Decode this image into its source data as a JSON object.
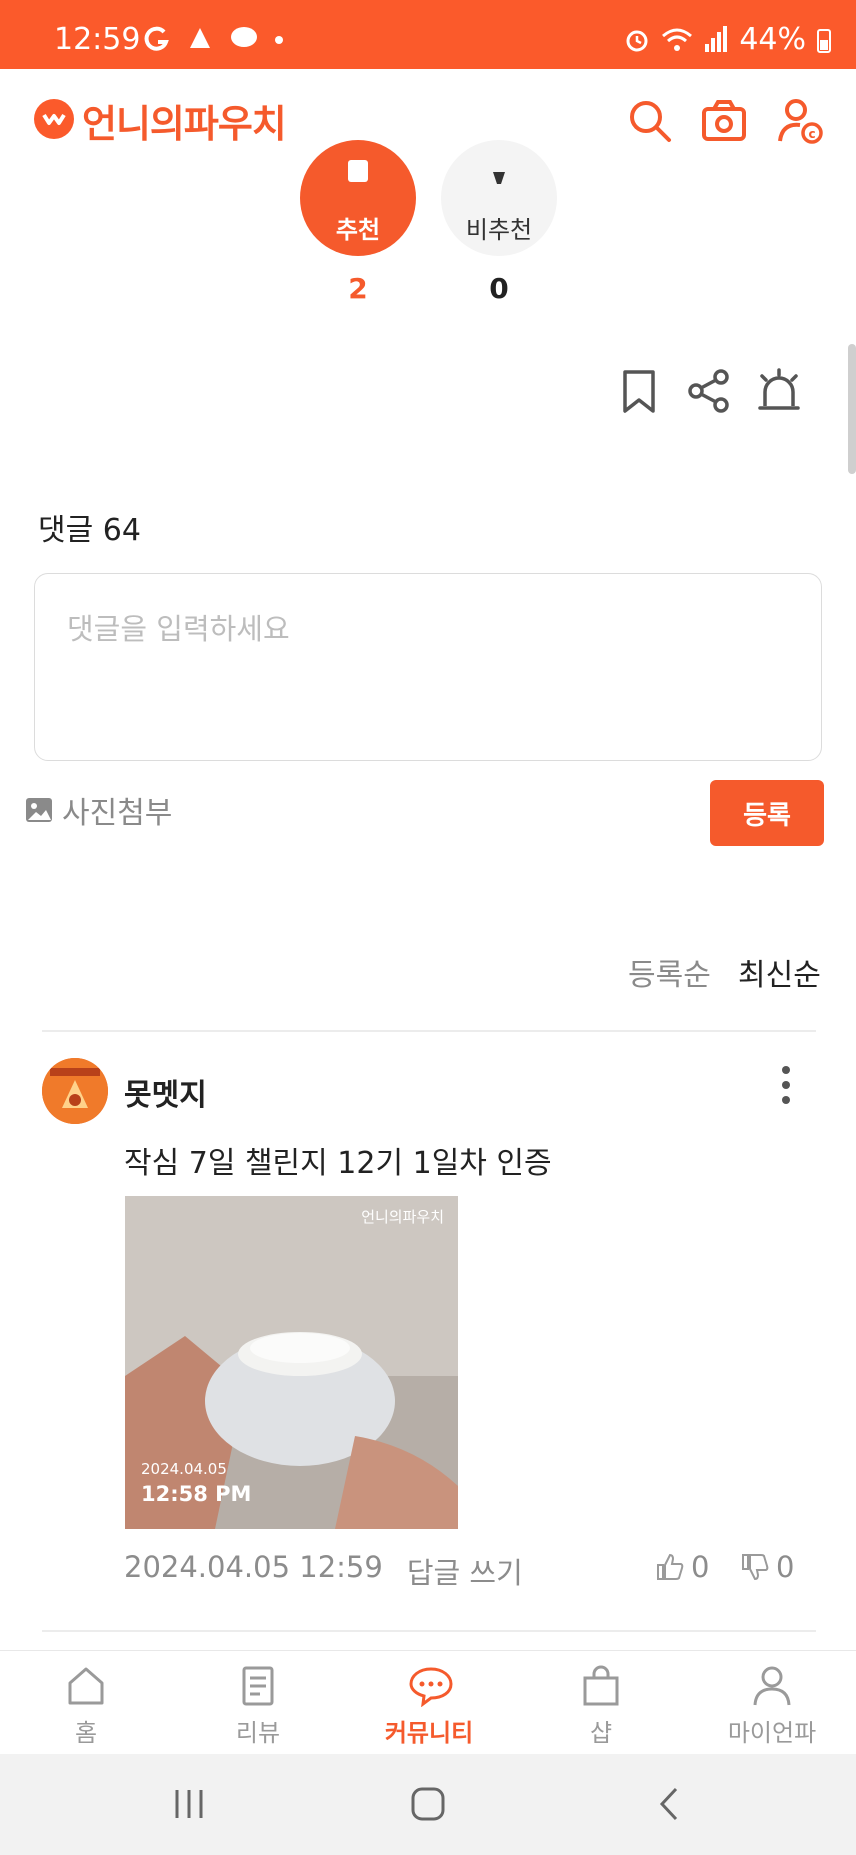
{
  "status_bar": {
    "time": "12:59",
    "battery": "44%",
    "left_icons": [
      "google-icon",
      "app-icon",
      "chat-icon",
      "dot"
    ],
    "right_icons": [
      "alarm-icon",
      "wifi-icon",
      "signal-icon",
      "battery-icon"
    ]
  },
  "header": {
    "logo_text": "언니의파우치",
    "icons": [
      "search-icon",
      "camera-icon",
      "user-coin-icon"
    ],
    "accent": "#f55a2c"
  },
  "votes": {
    "up_label": "추천",
    "up_count": "2",
    "down_label": "비추천",
    "down_count": "0"
  },
  "actions": [
    "bookmark-icon",
    "share-icon",
    "report-siren-icon"
  ],
  "comments": {
    "title": "댓글 64",
    "input_placeholder": "댓글을 입력하세요",
    "attach_label": "사진첨부",
    "submit_label": "등록",
    "sort_options": [
      "등록순",
      "최신순"
    ],
    "sort_selected": "최신순"
  },
  "comment_item": {
    "author": "못멧지",
    "text": "작심 7일 챌린지 12기 1일차 인증",
    "image_watermark": "언니의파우치",
    "image_date": "2024.04.05",
    "image_time": "12:58 PM",
    "timestamp": "2024.04.05 12:59",
    "reply_label": "답글 쓰기",
    "likes": "0",
    "dislikes": "0"
  },
  "bottom_nav": [
    {
      "label": "홈",
      "icon": "home-icon",
      "active": false
    },
    {
      "label": "리뷰",
      "icon": "review-icon",
      "active": false
    },
    {
      "label": "커뮤니티",
      "icon": "community-icon",
      "active": true
    },
    {
      "label": "샵",
      "icon": "shop-icon",
      "active": false
    },
    {
      "label": "마이언파",
      "icon": "profile-icon",
      "active": false
    }
  ],
  "system_nav": [
    "recents-icon",
    "home-button-icon",
    "back-icon"
  ]
}
